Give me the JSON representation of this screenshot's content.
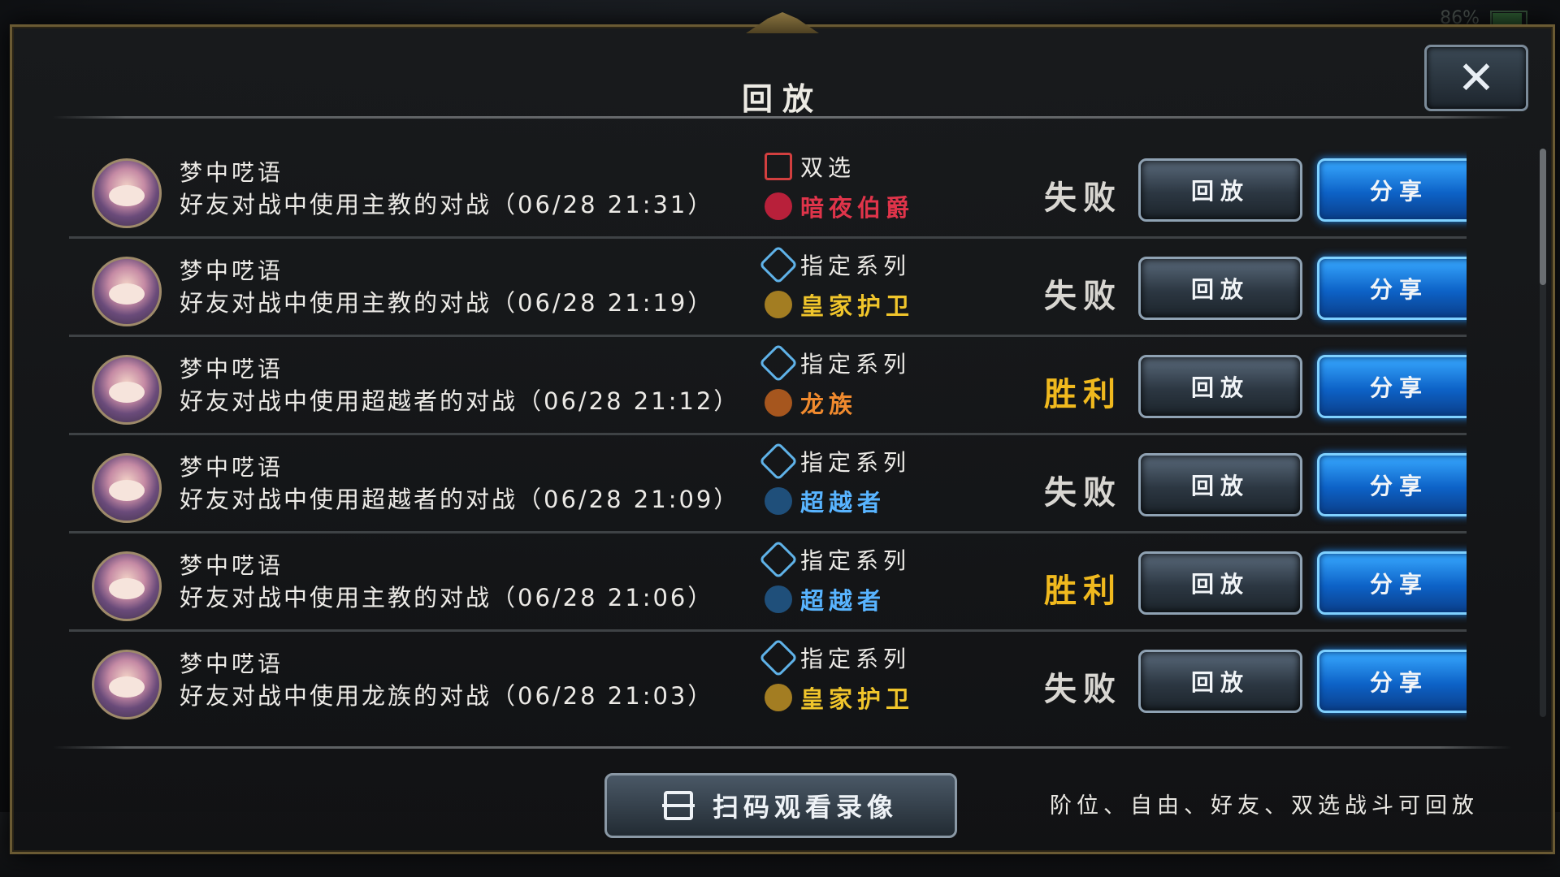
{
  "status": {
    "battery": "86"
  },
  "modal": {
    "title": "回放",
    "close_label": "✕"
  },
  "buttons": {
    "replay_label": "回放",
    "share_label": "分享"
  },
  "rows": [
    {
      "player": "梦中呓语",
      "desc": "好友对战中使用主教的对战（06/28 21:31）",
      "mode": "双选",
      "mode_icon": "double-select-icon",
      "class": "暗夜伯爵",
      "class_color": "#e0344a",
      "class_icon": "night-count-icon",
      "result": "失败",
      "result_type": "lose"
    },
    {
      "player": "梦中呓语",
      "desc": "好友对战中使用主教的对战（06/28 21:19）",
      "mode": "指定系列",
      "mode_icon": "rotation-icon",
      "class": "皇家护卫",
      "class_color": "#f0c52b",
      "class_icon": "royal-guard-icon",
      "result": "失败",
      "result_type": "lose"
    },
    {
      "player": "梦中呓语",
      "desc": "好友对战中使用超越者的对战（06/28 21:12）",
      "mode": "指定系列",
      "mode_icon": "rotation-icon",
      "class": "龙族",
      "class_color": "#f08a2e",
      "class_icon": "dragon-icon",
      "result": "胜利",
      "result_type": "win"
    },
    {
      "player": "梦中呓语",
      "desc": "好友对战中使用超越者的对战（06/28 21:09）",
      "mode": "指定系列",
      "mode_icon": "rotation-icon",
      "class": "超越者",
      "class_color": "#58b4ff",
      "class_icon": "transcender-icon",
      "result": "失败",
      "result_type": "lose"
    },
    {
      "player": "梦中呓语",
      "desc": "好友对战中使用主教的对战（06/28 21:06）",
      "mode": "指定系列",
      "mode_icon": "rotation-icon",
      "class": "超越者",
      "class_color": "#58b4ff",
      "class_icon": "transcender-icon",
      "result": "胜利",
      "result_type": "win"
    },
    {
      "player": "梦中呓语",
      "desc": "好友对战中使用龙族的对战（06/28 21:03）",
      "mode": "指定系列",
      "mode_icon": "rotation-icon",
      "class": "皇家护卫",
      "class_color": "#f0c52b",
      "class_icon": "royal-guard-icon",
      "result": "失败",
      "result_type": "lose"
    }
  ],
  "footer": {
    "scan_label": "扫码观看录像",
    "note": "阶位、自由、好友、双选战斗可回放"
  }
}
